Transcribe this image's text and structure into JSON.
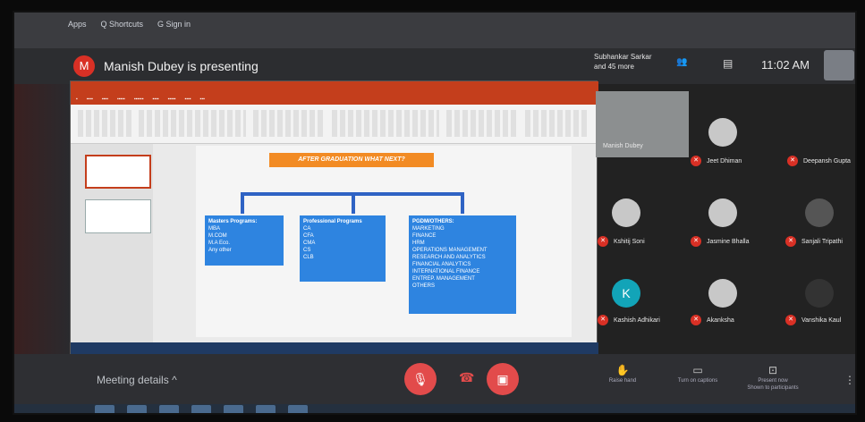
{
  "browser": {
    "bookmarks": [
      "Apps",
      "Q  Shortcuts",
      "G  Sign in"
    ]
  },
  "header": {
    "presenter_initial": "M",
    "presenting_text": "Manish Dubey is presenting",
    "participants_text": "Subhankar Sarkar and 45 more",
    "clock": "11:02 AM"
  },
  "slide": {
    "title": "AFTER GRADUATION WHAT NEXT?",
    "boxes": [
      {
        "heading": "Masters Programs:",
        "items": [
          "MBA",
          "M.COM",
          "M.A Eco.",
          "Any other"
        ]
      },
      {
        "heading": "Professional Programs",
        "items": [
          "CA",
          "CFA",
          "CMA",
          "CS",
          "CLB"
        ]
      },
      {
        "heading": "PGDM/OTHERS:",
        "items": [
          "MARKETING",
          "FINANCE",
          "HRM",
          "OPERATIONS MANAGEMENT",
          "RESEARCH AND ANALYTICS",
          "FINANCIAL ANALYTICS",
          "INTERNATIONAL FINANCE",
          "ENTREP. MANAGEMENT",
          "OTHERS"
        ]
      }
    ]
  },
  "participants": [
    {
      "name": "Manish Dubey",
      "initial": ""
    },
    {
      "name": "Jeet Dhiman",
      "initial": ""
    },
    {
      "name": "Deepansh Gupta",
      "initial": ""
    },
    {
      "name": "Kshitij Soni",
      "initial": ""
    },
    {
      "name": "Jasmine Bhalla",
      "initial": ""
    },
    {
      "name": "Sanjali Tripathi",
      "initial": ""
    },
    {
      "name": "Kashish Adhikari",
      "initial": "K"
    },
    {
      "name": "Akanksha",
      "initial": ""
    },
    {
      "name": "Vanshika Kaul",
      "initial": ""
    }
  ],
  "bottom": {
    "meeting_details": "Meeting details",
    "chevron": "^",
    "controls": [
      "Raise hand",
      "Turn on captions",
      "Present now"
    ],
    "right_sub": "Shown to participants"
  },
  "icons": {
    "mic_off": "mic-off-icon",
    "hangup": "phone-hangup-icon",
    "cam_off": "camera-off-icon"
  },
  "colors": {
    "mute_red": "#d93025",
    "slide_orange": "#f28b24",
    "slide_blue": "#2e84e0",
    "ppt_red": "#c43e1c"
  }
}
